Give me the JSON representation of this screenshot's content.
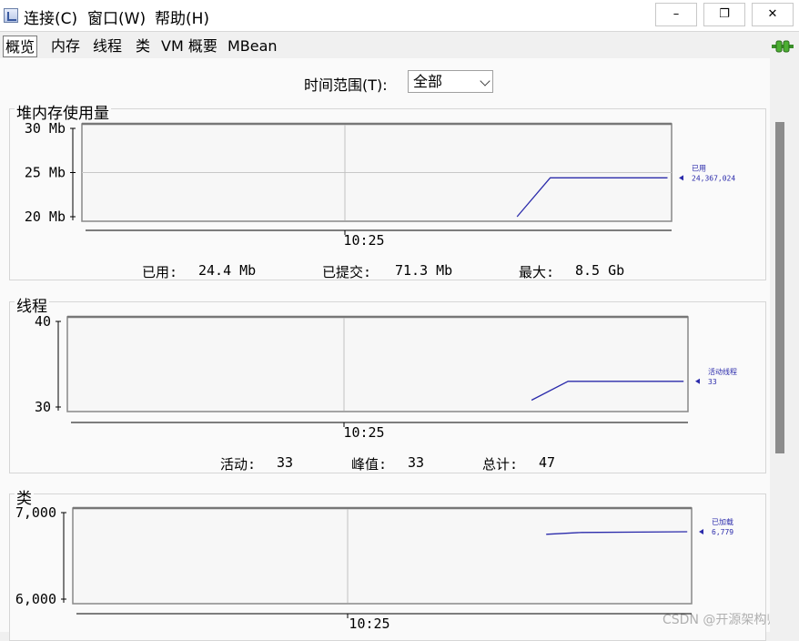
{
  "menubar": {
    "items": [
      {
        "label": "连接(C)"
      },
      {
        "label": "窗口(W)"
      },
      {
        "label": "帮助(H)"
      }
    ],
    "minimize": "–",
    "restore": "❐",
    "close": "✕"
  },
  "tabs": [
    {
      "label": "概览",
      "active": true
    },
    {
      "label": "内存"
    },
    {
      "label": "线程"
    },
    {
      "label": "类"
    },
    {
      "label": "VM 概要"
    },
    {
      "label": "MBean"
    }
  ],
  "time_range": {
    "label": "时间范围(T):",
    "value": "全部"
  },
  "accent_color": "#2b2bab",
  "panels": {
    "heap": {
      "title": "堆内存使用量",
      "stats": {
        "used_label": "已用:",
        "used_value": "24.4 Mb",
        "committed_label": "已提交:",
        "committed_value": "71.3 Mb",
        "max_label": "最大:",
        "max_value": "8.5 Gb"
      }
    },
    "threads": {
      "title": "线程",
      "stats": {
        "live_label": "活动:",
        "live_value": "33",
        "peak_label": "峰值:",
        "peak_value": "33",
        "total_label": "总计:",
        "total_value": "47"
      }
    },
    "classes": {
      "title": "类"
    }
  },
  "chart_data": [
    {
      "type": "line",
      "yticks": [
        "30 Mb",
        "25 Mb",
        "20 Mb"
      ],
      "ylim": [
        20,
        30
      ],
      "xtick": "10:25",
      "series": [
        {
          "name": "已用",
          "current_label": "24,367,024",
          "points": [
            [
              0,
              20
            ],
            [
              0.22,
              24.4
            ],
            [
              1,
              24.4
            ]
          ]
        }
      ]
    },
    {
      "type": "line",
      "yticks": [
        "40",
        "30"
      ],
      "ylim": [
        30,
        40
      ],
      "xtick": "10:25",
      "series": [
        {
          "name": "活动线程",
          "current_label": "33",
          "points": [
            [
              0,
              30.8
            ],
            [
              0.24,
              33
            ],
            [
              1,
              33
            ]
          ]
        }
      ]
    },
    {
      "type": "line",
      "yticks": [
        "7,000",
        "6,000"
      ],
      "ylim": [
        6000,
        7000
      ],
      "xtick": "10:25",
      "series": [
        {
          "name": "已加载",
          "current_label": "6,779",
          "points": [
            [
              0,
              6750
            ],
            [
              0.25,
              6770
            ],
            [
              1,
              6779
            ]
          ]
        }
      ]
    }
  ],
  "watermark": "CSDN @开源架构师"
}
